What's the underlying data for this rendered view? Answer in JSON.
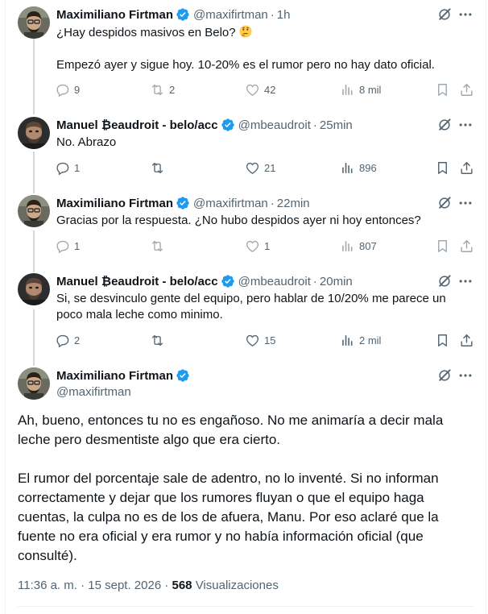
{
  "tweets": [
    {
      "name": "Maximiliano Firtman",
      "handle": "@maxifirtman",
      "time": "1h",
      "text_line1": "¿Hay despidos masivos en Belo?",
      "text_line2": "Empezó ayer y sigue hoy. 10-20% es el rumor pero no hay dato oficial.",
      "replies": "9",
      "reposts": "2",
      "likes": "42",
      "views": "8 mil"
    },
    {
      "name": "Manuel ₿eaudroit - belo/acc",
      "handle": "@mbeaudroit",
      "time": "25min",
      "text": "No. Abrazo",
      "replies": "1",
      "reposts": "",
      "likes": "21",
      "views": "896"
    },
    {
      "name": "Maximiliano Firtman",
      "handle": "@maxifirtman",
      "time": "22min",
      "text": "Gracias por la respuesta. ¿No hubo despidos ayer ni hoy entonces?",
      "replies": "1",
      "reposts": "",
      "likes": "1",
      "views": "807"
    },
    {
      "name": "Manuel ₿eaudroit - belo/acc",
      "handle": "@mbeaudroit",
      "time": "20min",
      "text_line1": "Si, se desvinculo gente del equipo, pero hablar de 10/20% me parece un",
      "text_line2": "poco mala leche como minimo.",
      "replies": "2",
      "reposts": "",
      "likes": "15",
      "views": "2 mil"
    }
  ],
  "main": {
    "name": "Maximiliano Firtman",
    "handle": "@maxifirtman",
    "para1": "Ah, bueno, entonces tu no es engañoso. No me animaría a decir mala leche pero desmentiste algo que era cierto.",
    "para2": "El rumor del porcentaje sale de adentro, no lo inventé. Si no informan correctamente y dejar que los rumores fluyan o que el equipo haga cuentas, la culpa no es de los de afuera, Manu. Por eso aclaré que la fuente no era oficial y era rumor y no había información oficial (que consulté).",
    "timestamp": "11:36 a. m. · 15 sept. 2026 · ",
    "views_count": "568",
    "views_label": "Visualizaciones"
  },
  "separator": "·",
  "icons": [
    "verified-icon",
    "grok-icon",
    "more-icon",
    "reply-icon",
    "repost-icon",
    "like-icon",
    "views-icon",
    "bookmark-icon",
    "share-icon",
    "thinking-face-emoji"
  ],
  "colors": {
    "text": "#0f1419",
    "secondary": "#536471",
    "verified": "#1d9bf0",
    "border": "#eff3f4",
    "thread": "#cfd9de"
  }
}
